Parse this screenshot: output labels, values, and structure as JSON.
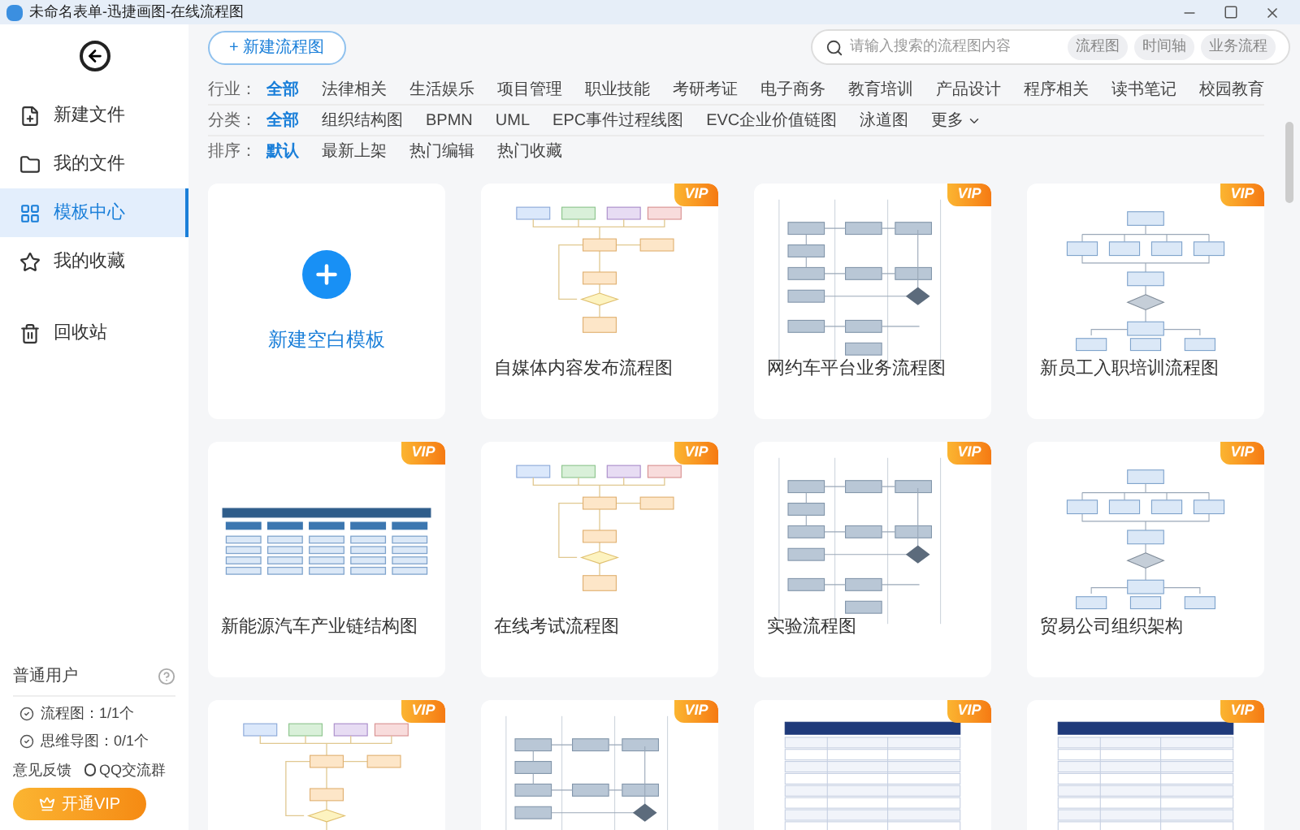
{
  "window": {
    "title": "未命名表单-迅捷画图-在线流程图"
  },
  "sidebar": {
    "items": [
      {
        "label": "新建文件",
        "kind": "new",
        "selected": false
      },
      {
        "label": "我的文件",
        "kind": "folder",
        "selected": false
      },
      {
        "label": "模板中心",
        "kind": "grid",
        "selected": true
      },
      {
        "label": "我的收藏",
        "kind": "star",
        "selected": false
      },
      {
        "label": "回收站",
        "kind": "trash",
        "selected": false
      }
    ],
    "user": {
      "title": "普通用户",
      "quotas": [
        "流程图：1/1个",
        "思维导图：0/1个"
      ],
      "feedback": "意见反馈",
      "qq": "QQ交流群",
      "vip_button": "开通VIP"
    }
  },
  "new_button": "+ 新建流程图",
  "search": {
    "placeholder": "请输入搜索的流程图内容",
    "tags": [
      "流程图",
      "时间轴",
      "业务流程"
    ]
  },
  "filters": [
    {
      "label": "行业：",
      "options": [
        {
          "text": "全部",
          "selected": true
        },
        {
          "text": "法律相关",
          "selected": false
        },
        {
          "text": "生活娱乐",
          "selected": false
        },
        {
          "text": "项目管理",
          "selected": false
        },
        {
          "text": "职业技能",
          "selected": false
        },
        {
          "text": "考研考证",
          "selected": false
        },
        {
          "text": "电子商务",
          "selected": false
        },
        {
          "text": "教育培训",
          "selected": false
        },
        {
          "text": "产品设计",
          "selected": false
        },
        {
          "text": "程序相关",
          "selected": false
        },
        {
          "text": "读书笔记",
          "selected": false
        },
        {
          "text": "校园教育",
          "selected": false
        }
      ]
    },
    {
      "label": "分类：",
      "options": [
        {
          "text": "全部",
          "selected": true
        },
        {
          "text": "组织结构图",
          "selected": false
        },
        {
          "text": "BPMN",
          "selected": false
        },
        {
          "text": "UML",
          "selected": false
        },
        {
          "text": "EPC事件过程线图",
          "selected": false
        },
        {
          "text": "EVC企业价值链图",
          "selected": false
        },
        {
          "text": "泳道图",
          "selected": false
        }
      ],
      "more": "更多"
    },
    {
      "label": "排序：",
      "options": [
        {
          "text": "默认",
          "selected": true
        },
        {
          "text": "最新上架",
          "selected": false
        },
        {
          "text": "热门编辑",
          "selected": false
        },
        {
          "text": "热门收藏",
          "selected": false
        }
      ]
    }
  ],
  "cards": [
    {
      "kind": "blank",
      "title": "新建空白模板"
    },
    {
      "kind": "flow",
      "title": "自媒体内容发布流程图",
      "vip_badge": "VIP"
    },
    {
      "kind": "swimlane",
      "title": "网约车平台业务流程图",
      "vip_badge": "VIP"
    },
    {
      "kind": "org",
      "title": "新员工入职培训流程图",
      "vip_badge": "VIP"
    },
    {
      "kind": "wide",
      "title": "新能源汽车产业链结构图",
      "vip_badge": "VIP"
    },
    {
      "kind": "flow",
      "title": "在线考试流程图",
      "vip_badge": "VIP"
    },
    {
      "kind": "swimlane",
      "title": "实验流程图",
      "vip_badge": "VIP"
    },
    {
      "kind": "org",
      "title": "贸易公司组织架构",
      "vip_badge": "VIP"
    },
    {
      "kind": "flow",
      "vip_badge": "VIP"
    },
    {
      "kind": "swimlane",
      "vip_badge": "VIP"
    },
    {
      "kind": "table",
      "vip_badge": "VIP"
    },
    {
      "kind": "table",
      "vip_badge": "VIP"
    }
  ]
}
